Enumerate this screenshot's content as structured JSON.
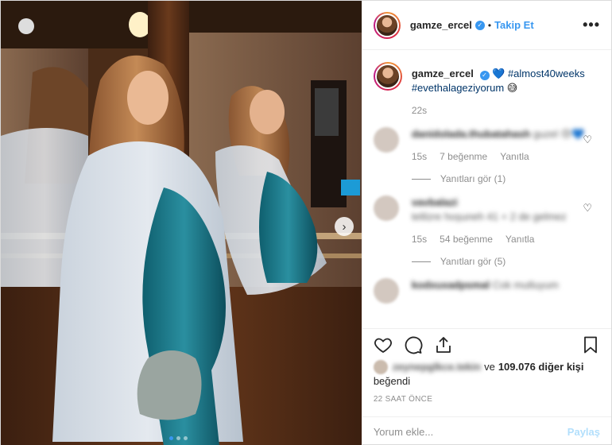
{
  "header": {
    "username": "gamze_ercel",
    "separator": "•",
    "follow_label": "Takip Et",
    "more_label": "•••"
  },
  "caption": {
    "username": "gamze_ercel",
    "heart": "💙",
    "tag1": "#almost40weeks",
    "tag2": "#evethalageziyorum",
    "emoji": "😅",
    "time": "22s"
  },
  "comments": [
    {
      "user": "danidolada.thubatahash",
      "text": "guzel 😢💙",
      "time": "15s",
      "likes": "7 beğenme",
      "reply": "Yanıtla",
      "view_replies": "Yanıtları gör (1)"
    },
    {
      "user": "vavbalazi",
      "text": "telilzre hoşuneh 41 + 2 de gelmez",
      "time": "15s",
      "likes": "54 beğenme",
      "reply": "Yanıtla",
      "view_replies": "Yanıtları gör (5)"
    },
    {
      "user": "kodxuxadpsmal",
      "text": "Cok mutluyum"
    }
  ],
  "likes": {
    "blurred_user": "zeynepglkce.tekin",
    "connector": "ve",
    "count": "109.076 diğer kişi",
    "suffix": "beğendi"
  },
  "post_time": "22 SAAT ÖNCE",
  "add_comment": {
    "placeholder": "Yorum ekle...",
    "post_label": "Paylaş"
  },
  "icons": {
    "next": "›",
    "check": "✓",
    "heart_outline": "♡"
  },
  "colors": {
    "accent": "#3897f0",
    "post_disabled": "#b2dffc"
  }
}
